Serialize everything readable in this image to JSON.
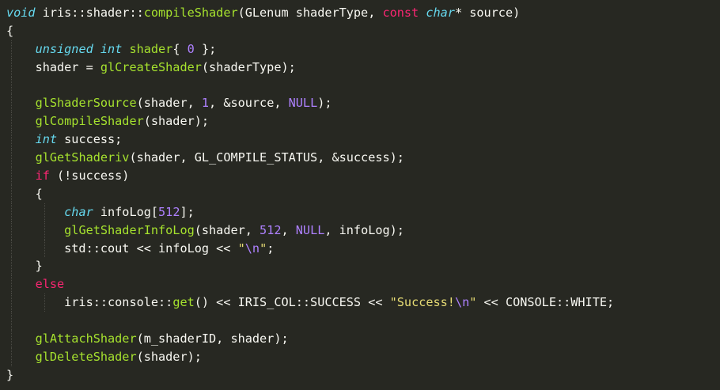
{
  "code_lines": [
    [
      {
        "t": "void",
        "c": "kw-type"
      },
      {
        "t": " iris::shader::",
        "c": "plain"
      },
      {
        "t": "compileShader",
        "c": "fn"
      },
      {
        "t": "(GLenum shaderType, ",
        "c": "plain"
      },
      {
        "t": "const",
        "c": "kw"
      },
      {
        "t": " ",
        "c": "plain"
      },
      {
        "t": "char",
        "c": "kw-type"
      },
      {
        "t": "* source)",
        "c": "plain"
      }
    ],
    [
      {
        "t": "{",
        "c": "plain"
      }
    ],
    [
      {
        "t": "    ",
        "c": "plain"
      },
      {
        "t": "unsigned int",
        "c": "kw-type"
      },
      {
        "t": " ",
        "c": "plain"
      },
      {
        "t": "shader",
        "c": "fn"
      },
      {
        "t": "{ ",
        "c": "plain"
      },
      {
        "t": "0",
        "c": "num"
      },
      {
        "t": " };",
        "c": "plain"
      }
    ],
    [
      {
        "t": "    shader = ",
        "c": "plain"
      },
      {
        "t": "glCreateShader",
        "c": "fn"
      },
      {
        "t": "(shaderType);",
        "c": "plain"
      }
    ],
    [],
    [
      {
        "t": "    ",
        "c": "plain"
      },
      {
        "t": "glShaderSource",
        "c": "fn"
      },
      {
        "t": "(shader, ",
        "c": "plain"
      },
      {
        "t": "1",
        "c": "num"
      },
      {
        "t": ", &source, ",
        "c": "plain"
      },
      {
        "t": "NULL",
        "c": "num"
      },
      {
        "t": ");",
        "c": "plain"
      }
    ],
    [
      {
        "t": "    ",
        "c": "plain"
      },
      {
        "t": "glCompileShader",
        "c": "fn"
      },
      {
        "t": "(shader);",
        "c": "plain"
      }
    ],
    [
      {
        "t": "    ",
        "c": "plain"
      },
      {
        "t": "int",
        "c": "kw-type"
      },
      {
        "t": " success;",
        "c": "plain"
      }
    ],
    [
      {
        "t": "    ",
        "c": "plain"
      },
      {
        "t": "glGetShaderiv",
        "c": "fn"
      },
      {
        "t": "(shader, GL_COMPILE_STATUS, &success);",
        "c": "plain"
      }
    ],
    [
      {
        "t": "    ",
        "c": "plain"
      },
      {
        "t": "if",
        "c": "kw"
      },
      {
        "t": " (!success)",
        "c": "plain"
      }
    ],
    [
      {
        "t": "    {",
        "c": "plain"
      }
    ],
    [
      {
        "t": "        ",
        "c": "plain"
      },
      {
        "t": "char",
        "c": "kw-type"
      },
      {
        "t": " infoLog[",
        "c": "plain"
      },
      {
        "t": "512",
        "c": "num"
      },
      {
        "t": "];",
        "c": "plain"
      }
    ],
    [
      {
        "t": "        ",
        "c": "plain"
      },
      {
        "t": "glGetShaderInfoLog",
        "c": "fn"
      },
      {
        "t": "(shader, ",
        "c": "plain"
      },
      {
        "t": "512",
        "c": "num"
      },
      {
        "t": ", ",
        "c": "plain"
      },
      {
        "t": "NULL",
        "c": "num"
      },
      {
        "t": ", infoLog);",
        "c": "plain"
      }
    ],
    [
      {
        "t": "        std::cout << infoLog << ",
        "c": "plain"
      },
      {
        "t": "\"",
        "c": "str"
      },
      {
        "t": "\\n",
        "c": "esc"
      },
      {
        "t": "\"",
        "c": "str"
      },
      {
        "t": ";",
        "c": "plain"
      }
    ],
    [
      {
        "t": "    }",
        "c": "plain"
      }
    ],
    [
      {
        "t": "    ",
        "c": "plain"
      },
      {
        "t": "else",
        "c": "kw"
      }
    ],
    [
      {
        "t": "        iris::console::",
        "c": "plain"
      },
      {
        "t": "get",
        "c": "fn"
      },
      {
        "t": "() << IRIS_COL::SUCCESS << ",
        "c": "plain"
      },
      {
        "t": "\"Success!",
        "c": "str"
      },
      {
        "t": "\\n",
        "c": "esc"
      },
      {
        "t": "\"",
        "c": "str"
      },
      {
        "t": " << CONSOLE::WHITE;",
        "c": "plain"
      }
    ],
    [],
    [
      {
        "t": "    ",
        "c": "plain"
      },
      {
        "t": "glAttachShader",
        "c": "fn"
      },
      {
        "t": "(m_shaderID, shader);",
        "c": "plain"
      }
    ],
    [
      {
        "t": "    ",
        "c": "plain"
      },
      {
        "t": "glDeleteShader",
        "c": "fn"
      },
      {
        "t": "(shader);",
        "c": "plain"
      }
    ],
    [
      {
        "t": "}",
        "c": "plain"
      }
    ]
  ],
  "theme": {
    "background": "#272822",
    "foreground": "#f8f8f2",
    "keyword": "#f92672",
    "type": "#66d9ef",
    "function": "#a6e22e",
    "number": "#ae81ff",
    "string": "#e6db74"
  }
}
